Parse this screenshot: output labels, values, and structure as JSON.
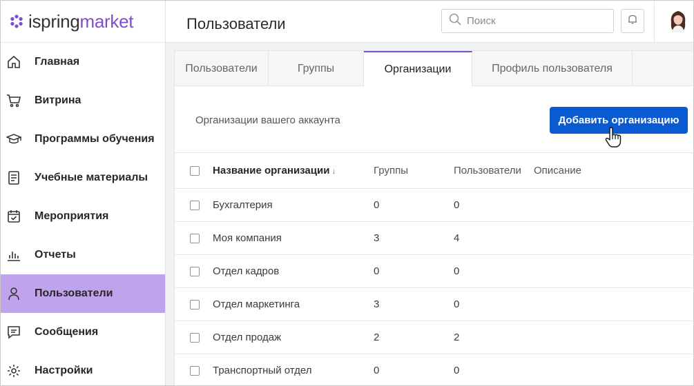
{
  "logo": {
    "part1": "ispring",
    "part2": "market"
  },
  "sidebar": {
    "items": [
      {
        "label": "Главная",
        "icon": "home-icon"
      },
      {
        "label": "Витрина",
        "icon": "cart-icon"
      },
      {
        "label": "Программы обучения",
        "icon": "graduation-cap-icon"
      },
      {
        "label": "Учебные материалы",
        "icon": "document-icon"
      },
      {
        "label": "Мероприятия",
        "icon": "calendar-check-icon"
      },
      {
        "label": "Отчеты",
        "icon": "bar-chart-icon"
      },
      {
        "label": "Пользователи",
        "icon": "user-icon",
        "active": true
      },
      {
        "label": "Сообщения",
        "icon": "message-icon"
      },
      {
        "label": "Настройки",
        "icon": "gear-icon"
      }
    ]
  },
  "header": {
    "title": "Пользователи",
    "search_placeholder": "Поиск"
  },
  "tabs": [
    {
      "label": "Пользователи"
    },
    {
      "label": "Группы"
    },
    {
      "label": "Организации",
      "active": true
    },
    {
      "label": "Профиль пользователя"
    }
  ],
  "toolbar": {
    "caption": "Организации вашего аккаунта",
    "add_label": "Добавить организацию"
  },
  "table": {
    "headers": {
      "name": "Название организации",
      "sort": "↓",
      "groups": "Группы",
      "users": "Пользователи",
      "description": "Описание"
    },
    "rows": [
      {
        "name": "Бухгалтерия",
        "groups": "0",
        "users": "0"
      },
      {
        "name": "Моя компания",
        "groups": "3",
        "users": "4"
      },
      {
        "name": "Отдел кадров",
        "groups": "0",
        "users": "0"
      },
      {
        "name": "Отдел маркетинга",
        "groups": "3",
        "users": "0"
      },
      {
        "name": "Отдел продаж",
        "groups": "2",
        "users": "2"
      },
      {
        "name": "Транспортный отдел",
        "groups": "0",
        "users": "0"
      }
    ]
  },
  "colors": {
    "brand": "#7f4ccf",
    "active_nav": "#c0a3ec",
    "primary_button": "#0a5ad2"
  }
}
